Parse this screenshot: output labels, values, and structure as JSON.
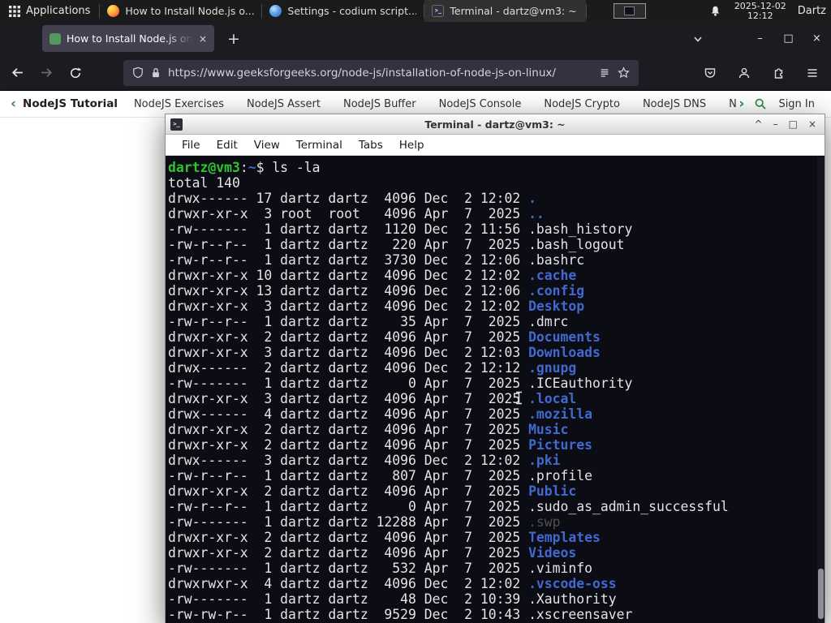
{
  "panel": {
    "applications_label": "Applications",
    "windows": [
      {
        "title": "How to Install Node.js o...",
        "icon": "firefox"
      },
      {
        "title": "Settings - codium script...",
        "icon": "settings"
      },
      {
        "title": "Terminal - dartz@vm3: ~",
        "icon": "terminal"
      }
    ],
    "clock_date": "2025-12-02",
    "clock_time": "12:12",
    "user": "Dartz"
  },
  "browser": {
    "tab_title": "How to Install Node.js on...",
    "url": "https://www.geeksforgeeks.org/node-js/installation-of-node-js-on-linux/"
  },
  "site_nav": {
    "brand": "NodeJS Tutorial",
    "links": [
      "NodeJS Exercises",
      "NodeJS Assert",
      "NodeJS Buffer",
      "NodeJS Console",
      "NodeJS Crypto",
      "NodeJS DNS",
      "Node"
    ],
    "sign_in": "Sign In"
  },
  "icons": {
    "chevron_left": "‹",
    "chevron_right": "›",
    "plus": "+",
    "minimize": "–",
    "maximize": "□",
    "close": "×",
    "shade": "^",
    "terminal_glyph": ">_"
  },
  "colors": {
    "gfg_green": "#2f8d46",
    "terminal_bg": "#0c0c14",
    "prompt_green": "#31c431",
    "dir_blue": "#4169d0",
    "firefox_chrome": "#1c1b22"
  },
  "terminal": {
    "window_title": "Terminal - dartz@vm3: ~",
    "menu": [
      "File",
      "Edit",
      "View",
      "Terminal",
      "Tabs",
      "Help"
    ],
    "prompt": {
      "user_host": "dartz@vm3",
      "colon": ":",
      "path": "~",
      "dollar": "$ ",
      "command": "ls -la"
    },
    "total_line": "total 140",
    "rows": [
      {
        "pre": "drwx------ 17 dartz dartz  4096 Dec  2 12:02 ",
        "name": ".",
        "style": "dir"
      },
      {
        "pre": "drwxr-xr-x  3 root  root   4096 Apr  7  2025 ",
        "name": "..",
        "style": "dir"
      },
      {
        "pre": "-rw-------  1 dartz dartz  1120 Dec  2 11:56 ",
        "name": ".bash_history",
        "style": "plain"
      },
      {
        "pre": "-rw-r--r--  1 dartz dartz   220 Apr  7  2025 ",
        "name": ".bash_logout",
        "style": "plain"
      },
      {
        "pre": "-rw-r--r--  1 dartz dartz  3730 Dec  2 12:06 ",
        "name": ".bashrc",
        "style": "plain"
      },
      {
        "pre": "drwxr-xr-x 10 dartz dartz  4096 Dec  2 12:02 ",
        "name": ".cache",
        "style": "dir"
      },
      {
        "pre": "drwxr-xr-x 13 dartz dartz  4096 Dec  2 12:06 ",
        "name": ".config",
        "style": "dir"
      },
      {
        "pre": "drwxr-xr-x  3 dartz dartz  4096 Dec  2 12:02 ",
        "name": "Desktop",
        "style": "dir"
      },
      {
        "pre": "-rw-r--r--  1 dartz dartz    35 Apr  7  2025 ",
        "name": ".dmrc",
        "style": "plain"
      },
      {
        "pre": "drwxr-xr-x  2 dartz dartz  4096 Apr  7  2025 ",
        "name": "Documents",
        "style": "dir"
      },
      {
        "pre": "drwxr-xr-x  3 dartz dartz  4096 Dec  2 12:03 ",
        "name": "Downloads",
        "style": "dir"
      },
      {
        "pre": "drwx------  2 dartz dartz  4096 Dec  2 12:12 ",
        "name": ".gnupg",
        "style": "dir"
      },
      {
        "pre": "-rw-------  1 dartz dartz     0 Apr  7  2025 ",
        "name": ".ICEauthority",
        "style": "plain"
      },
      {
        "pre": "drwxr-xr-x  3 dartz dartz  4096 Apr  7  2025 ",
        "name": ".local",
        "style": "dir"
      },
      {
        "pre": "drwx------  4 dartz dartz  4096 Apr  7  2025 ",
        "name": ".mozilla",
        "style": "dir"
      },
      {
        "pre": "drwxr-xr-x  2 dartz dartz  4096 Apr  7  2025 ",
        "name": "Music",
        "style": "dir"
      },
      {
        "pre": "drwxr-xr-x  2 dartz dartz  4096 Apr  7  2025 ",
        "name": "Pictures",
        "style": "dir"
      },
      {
        "pre": "drwx------  3 dartz dartz  4096 Dec  2 12:02 ",
        "name": ".pki",
        "style": "dir"
      },
      {
        "pre": "-rw-r--r--  1 dartz dartz   807 Apr  7  2025 ",
        "name": ".profile",
        "style": "plain"
      },
      {
        "pre": "drwxr-xr-x  2 dartz dartz  4096 Apr  7  2025 ",
        "name": "Public",
        "style": "dir"
      },
      {
        "pre": "-rw-r--r--  1 dartz dartz     0 Apr  7  2025 ",
        "name": ".sudo_as_admin_successful",
        "style": "plain"
      },
      {
        "pre": "-rw-------  1 dartz dartz 12288 Apr  7  2025 ",
        "name": ".swp",
        "style": "dim"
      },
      {
        "pre": "drwxr-xr-x  2 dartz dartz  4096 Apr  7  2025 ",
        "name": "Templates",
        "style": "dir"
      },
      {
        "pre": "drwxr-xr-x  2 dartz dartz  4096 Apr  7  2025 ",
        "name": "Videos",
        "style": "dir"
      },
      {
        "pre": "-rw-------  1 dartz dartz   532 Apr  7  2025 ",
        "name": ".viminfo",
        "style": "plain"
      },
      {
        "pre": "drwxrwxr-x  4 dartz dartz  4096 Dec  2 12:02 ",
        "name": ".vscode-oss",
        "style": "dir"
      },
      {
        "pre": "-rw-------  1 dartz dartz    48 Dec  2 10:39 ",
        "name": ".Xauthority",
        "style": "plain"
      },
      {
        "pre": "-rw-rw-r--  1 dartz dartz  9529 Dec  2 10:43 ",
        "name": ".xscreensaver",
        "style": "plain"
      }
    ]
  }
}
